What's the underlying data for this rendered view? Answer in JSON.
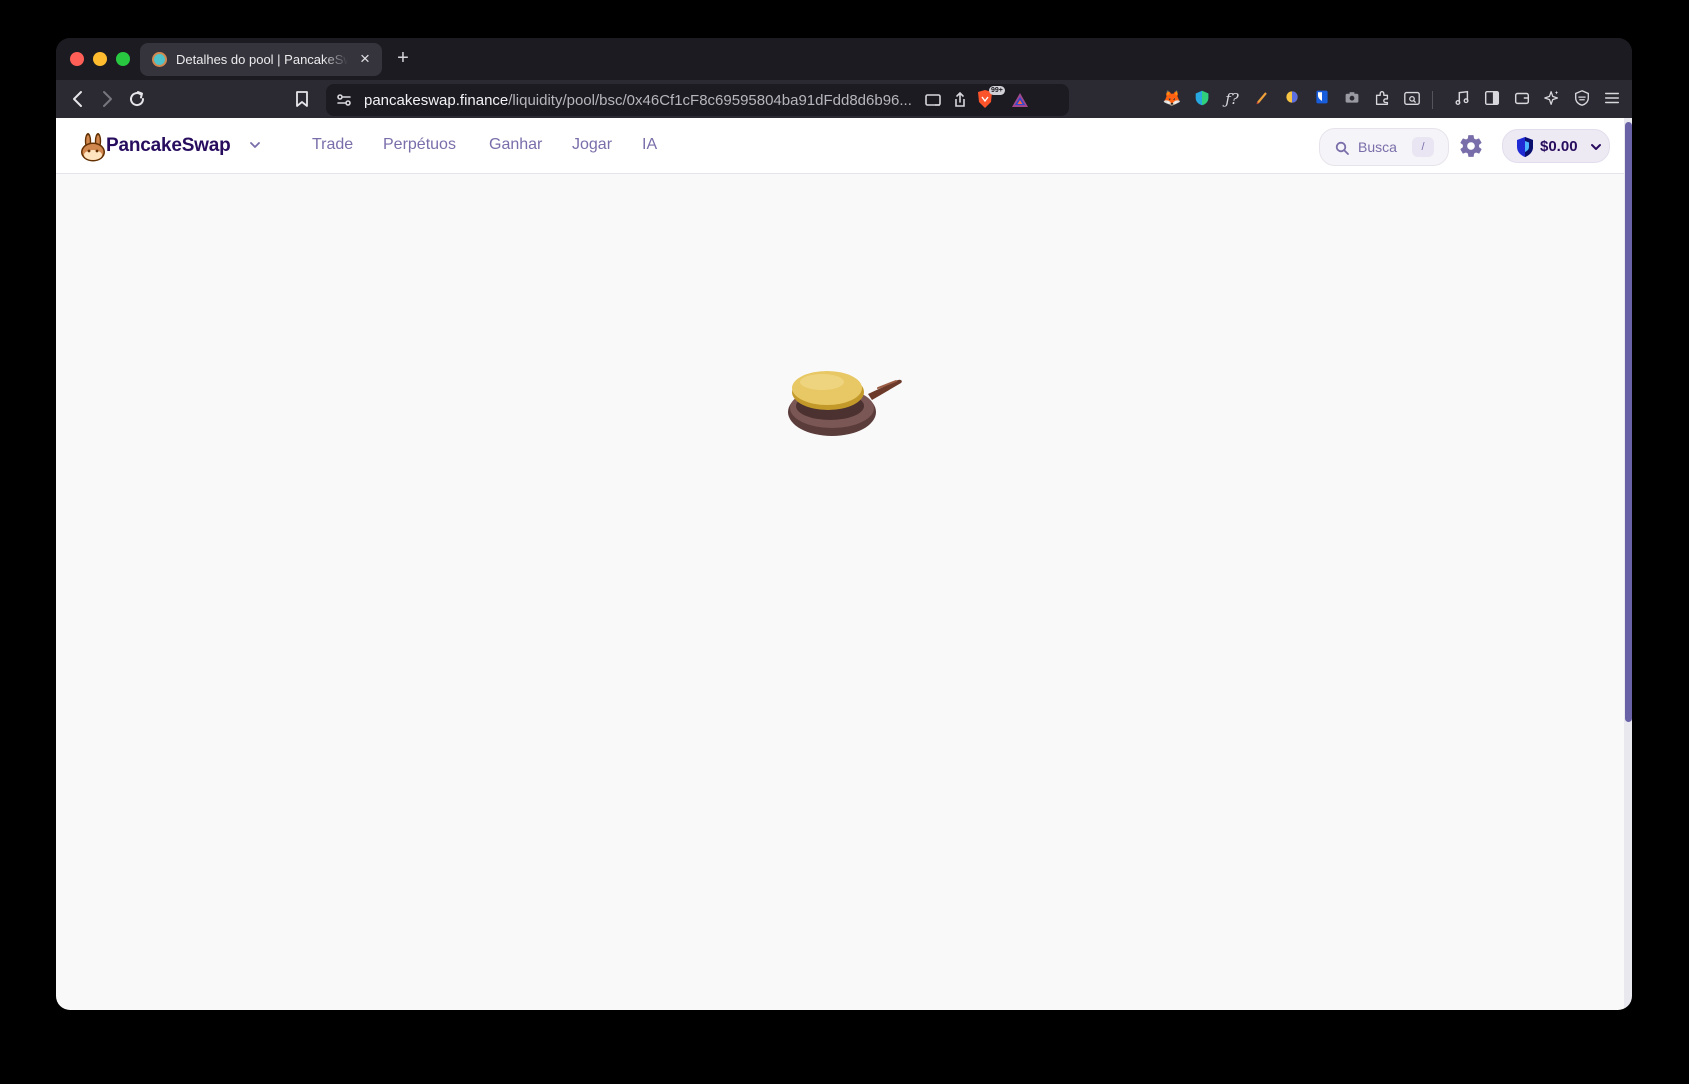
{
  "browser": {
    "tab": {
      "title": "Detalhes do pool | PancakeSwap",
      "close_icon": "×"
    },
    "new_tab_icon": "+",
    "url": {
      "host": "pancakeswap.finance",
      "path": "/liquidity/pool/bsc/0x46Cf1cF8c69595804ba91dFdd8d6b96..."
    },
    "shields_badge": "99+"
  },
  "app": {
    "brand": "PancakeSwap",
    "menu": [
      {
        "label": "Trade"
      },
      {
        "label": "Perpétuos"
      },
      {
        "label": "Ganhar"
      },
      {
        "label": "Jogar"
      },
      {
        "label": "IA"
      }
    ],
    "search": {
      "placeholder": "Busca",
      "shortcut": "/"
    },
    "wallet": {
      "balance": "$0.00"
    },
    "loading_icon": "frying-pan-pancake"
  },
  "colors": {
    "primary_text": "#280d5f",
    "secondary_text": "#7a6eaa",
    "page_bg": "#faf9fa",
    "scrollbar": "#6a62a6"
  }
}
